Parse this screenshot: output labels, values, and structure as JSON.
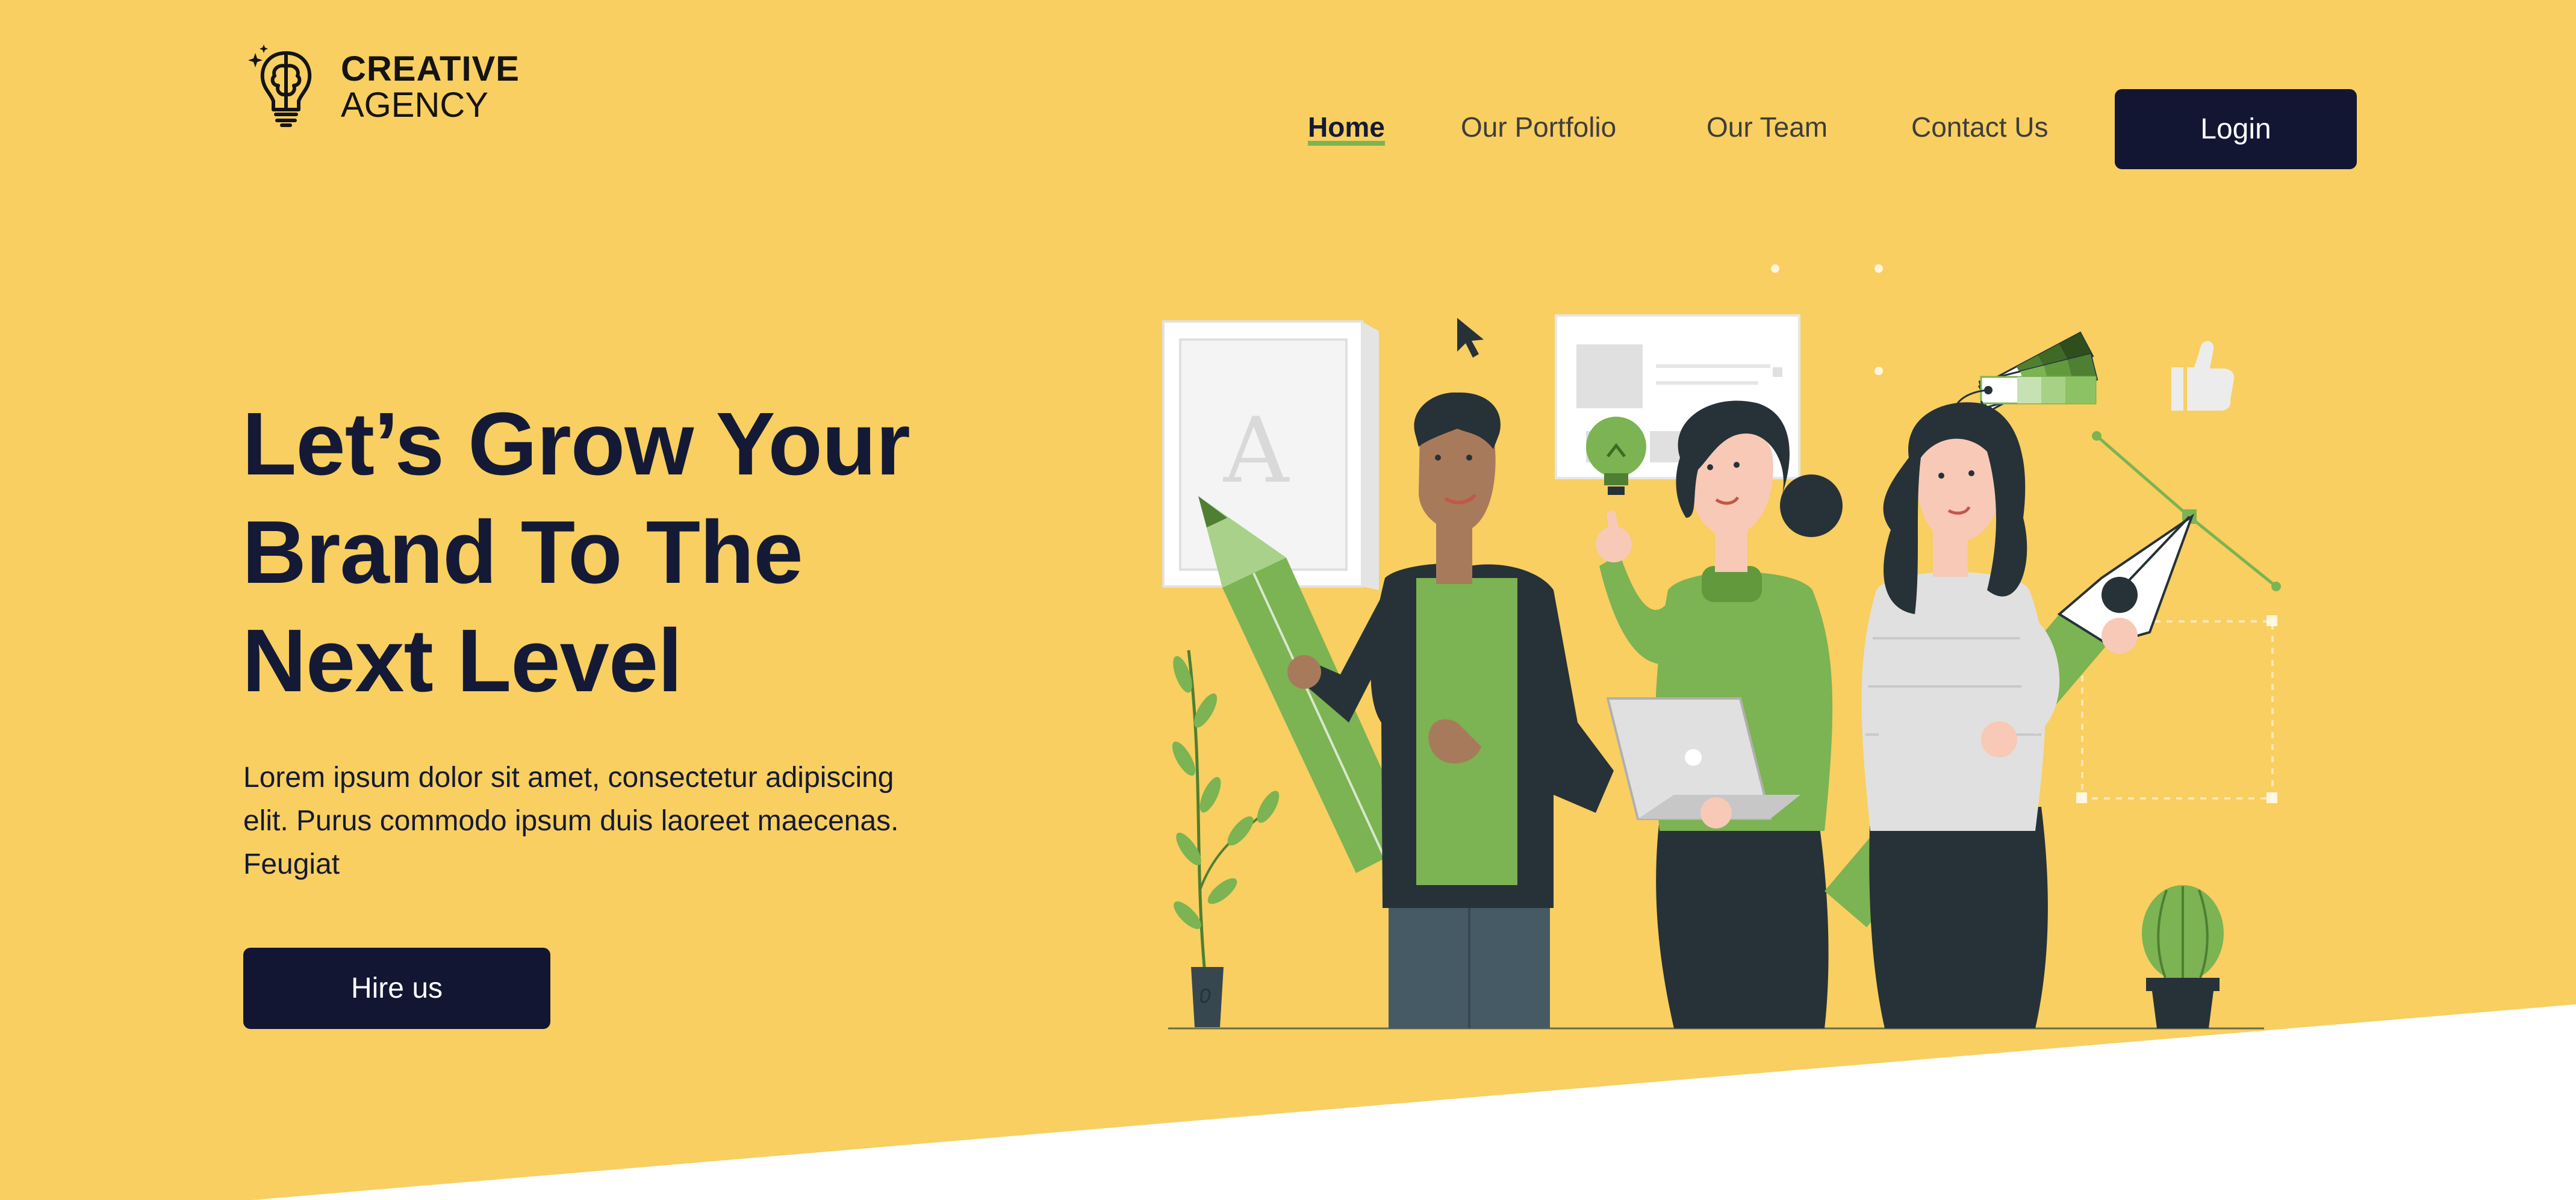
{
  "brand": {
    "name_line1": "CREATIVE",
    "name_line2": "AGENCY",
    "logo_icon": "brain-lightbulb-icon"
  },
  "nav": {
    "items": [
      {
        "label": "Home",
        "active": true
      },
      {
        "label": "Our Portfolio",
        "active": false
      },
      {
        "label": "Our Team",
        "active": false
      },
      {
        "label": "Contact Us",
        "active": false
      }
    ],
    "login_label": "Login"
  },
  "hero": {
    "headline": "Let’s Grow Your Brand To The Next Level",
    "body": "Lorem ipsum dolor sit amet, consectetur adipiscing elit. Purus commodo ipsum duis laoreet maecenas. Feugiat",
    "cta_label": "Hire us",
    "illustration_letter": "A"
  },
  "colors": {
    "background": "#f8cf60",
    "navy": "#121633",
    "accent_green": "#7cb353",
    "white": "#ffffff"
  }
}
